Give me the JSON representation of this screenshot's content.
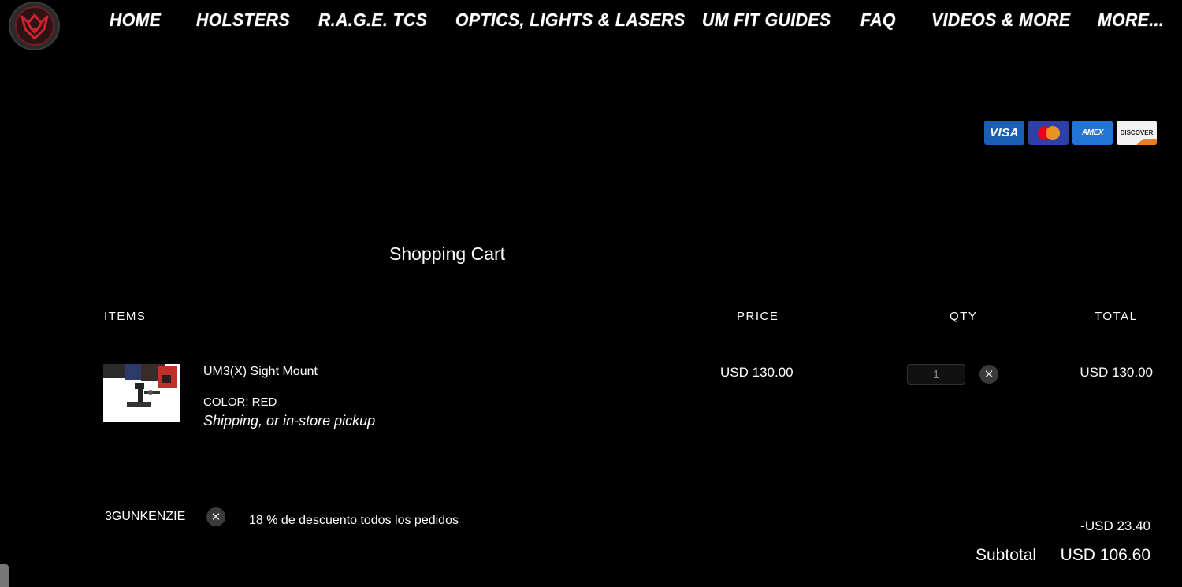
{
  "nav": {
    "items": [
      {
        "label": "HOME"
      },
      {
        "label": "HOLSTERS"
      },
      {
        "label": "R.A.G.E. TCS"
      },
      {
        "label": "OPTICS, LIGHTS & LASERS"
      },
      {
        "label": "UM FIT GUIDES"
      },
      {
        "label": "FAQ"
      },
      {
        "label": "VIDEOS & MORE"
      },
      {
        "label": "MORE..."
      }
    ]
  },
  "payment_cards": {
    "visa": "VISA",
    "amex": "AMEX",
    "discover": "DISCOVER"
  },
  "cart": {
    "title": "Shopping Cart",
    "headers": {
      "items": "ITEMS",
      "price": "PRICE",
      "qty": "QTY",
      "total": "TOTAL"
    },
    "item": {
      "name": "UM3(X) Sight Mount",
      "color": "COLOR: RED",
      "shipping": "Shipping, or in-store pickup",
      "price": "USD 130.00",
      "qty": "1",
      "total": "USD 130.00"
    },
    "coupon": {
      "code": "3GUNKENZIE",
      "description": "18 % de descuento todos los pedidos",
      "discount": "-USD 23.40"
    },
    "subtotal": {
      "label": "Subtotal",
      "value": "USD 106.60"
    }
  },
  "colors": {
    "background": "#000000",
    "logo_red": "#c0202c",
    "visa_blue": "#1a5fb4"
  },
  "icons": {
    "remove": "close-icon"
  }
}
